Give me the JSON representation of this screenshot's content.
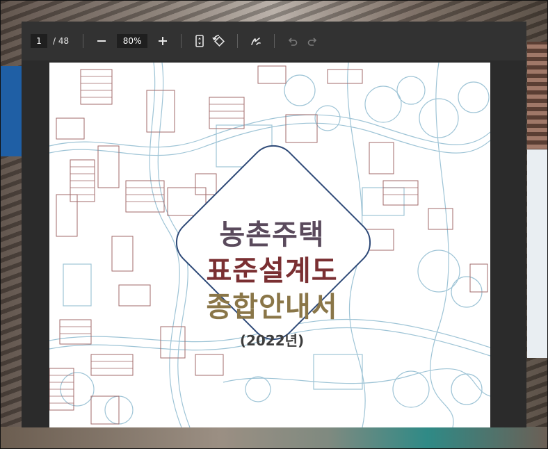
{
  "toolbar": {
    "page_current": "1",
    "page_total": "/ 48",
    "zoom": "80%",
    "zoom_out_icon": "minus-icon",
    "zoom_in_icon": "plus-icon",
    "fit_icon": "fit-page-icon",
    "rotate_icon": "rotate-icon",
    "draw_icon": "draw-icon",
    "undo_icon": "undo-icon",
    "redo_icon": "redo-icon"
  },
  "document": {
    "title_line1": "농촌주택",
    "title_line2": "표준설계도",
    "title_line3": "종합안내서",
    "year": "(2022년)"
  },
  "colors": {
    "map_lines": "#9ec4d6",
    "roofs": "#a06a6a",
    "diamond_border": "#2f4a78",
    "title_line1": "#5a4a5c",
    "title_line2": "#7a2f32",
    "title_line3": "#8a7648"
  }
}
